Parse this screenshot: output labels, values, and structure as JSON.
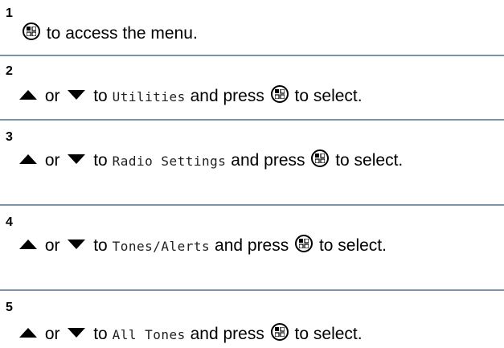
{
  "steps": [
    {
      "number": "1",
      "text_1": "to access the menu."
    },
    {
      "number": "2",
      "or": "or",
      "to": "to",
      "menu_item": "Utilities",
      "and_press": "and press",
      "to_select": "to select."
    },
    {
      "number": "3",
      "or": "or",
      "to": "to",
      "menu_item": "Radio Settings",
      "and_press": "and press",
      "to_select": "to select."
    },
    {
      "number": "4",
      "or": "or",
      "to": "to",
      "menu_item": "Tones/Alerts",
      "and_press": "and press",
      "to_select": "to select."
    },
    {
      "number": "5",
      "or": "or",
      "to": "to",
      "menu_item": "All Tones",
      "and_press": "and press",
      "to_select": "to select."
    }
  ],
  "icons": {
    "menu_ok_button": "menu-ok-button-icon",
    "up_arrow": "up-arrow-icon",
    "down_arrow": "down-arrow-icon"
  }
}
